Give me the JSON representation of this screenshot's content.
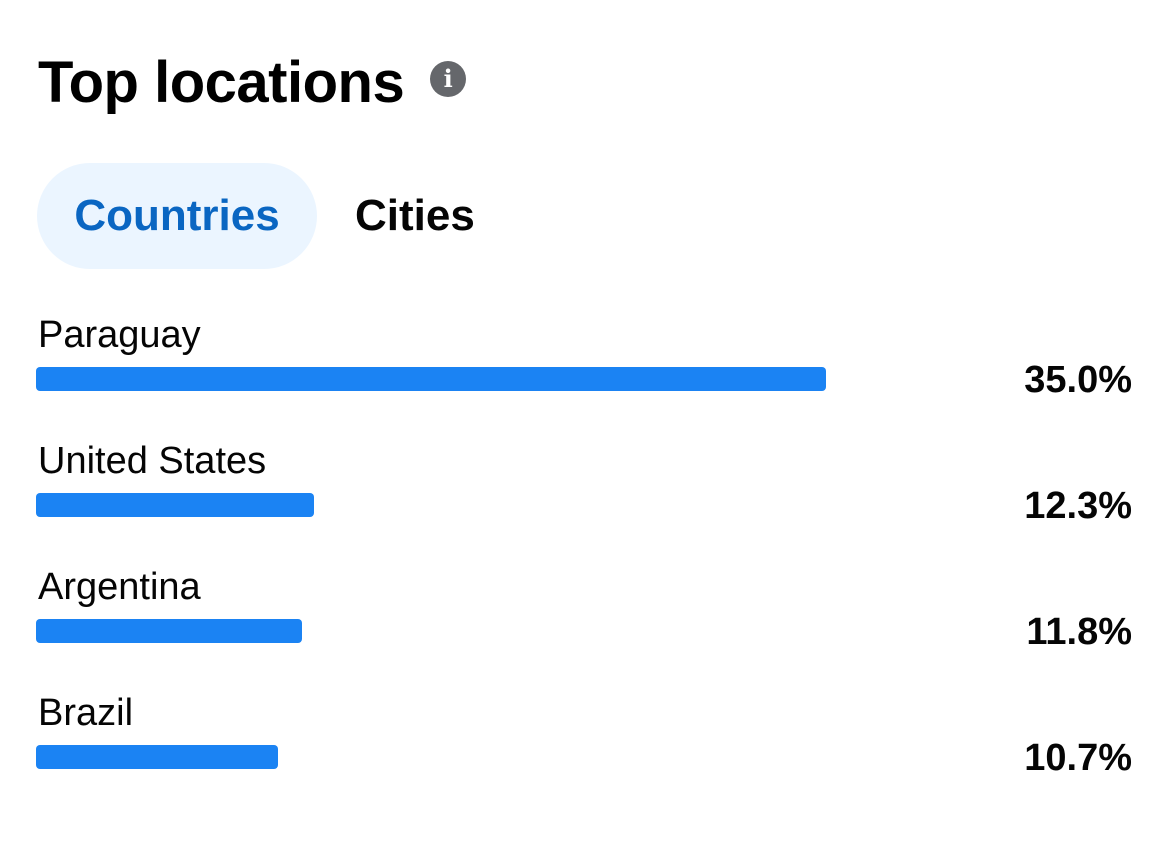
{
  "header": {
    "title": "Top locations",
    "info_icon": "info-icon"
  },
  "tabs": [
    {
      "label": "Countries",
      "active": true
    },
    {
      "label": "Cities",
      "active": false
    }
  ],
  "colors": {
    "accent": "#0a66c2",
    "active_tab_bg": "#ebf5ff",
    "bar": "#1b83f3",
    "info_icon": "#65676b"
  },
  "locations": [
    {
      "name": "Paraguay",
      "percent_label": "35.0%",
      "percent": 35.0
    },
    {
      "name": "United States",
      "percent_label": "12.3%",
      "percent": 12.3
    },
    {
      "name": "Argentina",
      "percent_label": "11.8%",
      "percent": 11.8
    },
    {
      "name": "Brazil",
      "percent_label": "10.7%",
      "percent": 10.7
    }
  ]
}
